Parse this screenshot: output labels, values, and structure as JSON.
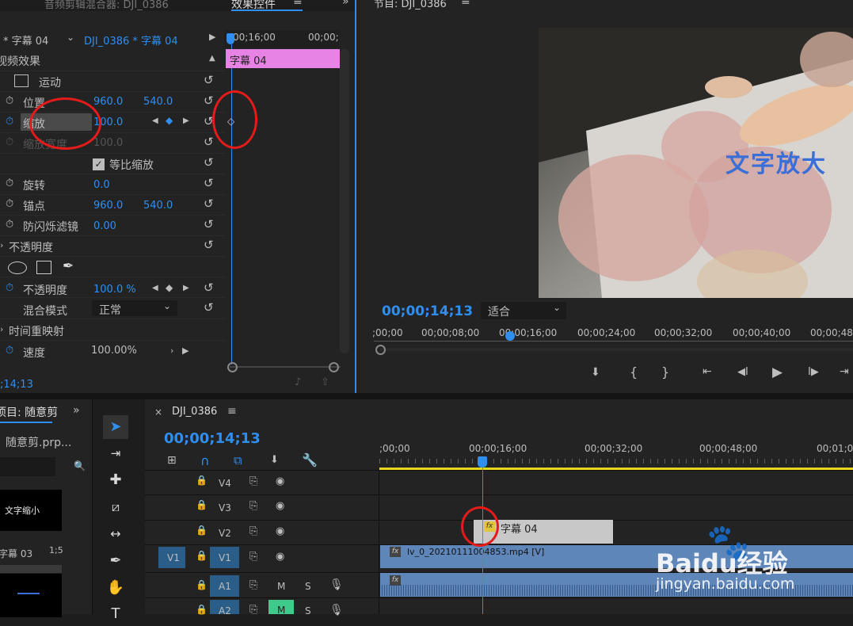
{
  "effect_controls": {
    "header_left": "音频剪辑混合器: DJI_0386",
    "header_tab": "效果控件",
    "source_clip": "* 字幕 04",
    "sequence_clip": "DJI_0386 * 字幕 04",
    "timecode_ruler": "00;16;00",
    "timecode_ruler_right": "00;00;",
    "clip_bar_label": "字幕 04",
    "video_effects_label": "视频效果",
    "motion_label": "运动",
    "position_label": "位置",
    "position_x": "960.0",
    "position_y": "540.0",
    "scale_label": "缩放",
    "scale_value": "100.0",
    "scale_width_label": "缩放宽度",
    "scale_width_value": "100.0",
    "uniform_scale_label": "等比缩放",
    "rotation_label": "旋转",
    "rotation_value": "0.0",
    "anchor_label": "锚点",
    "anchor_x": "960.0",
    "anchor_y": "540.0",
    "flicker_label": "防闪烁滤镜",
    "flicker_value": "0.00",
    "opacity_group_label": "不透明度",
    "opacity_label": "不透明度",
    "opacity_value": "100.0 %",
    "blend_label": "混合模式",
    "blend_value": "正常",
    "time_remap_label": "时间重映射",
    "speed_label": "速度",
    "speed_value": "100.00%",
    "bottom_timecode": ";14;13"
  },
  "program": {
    "header": "节目: DJI_0386",
    "overlay_text": "文字放大",
    "timecode": "00;00;14;13",
    "fit_label": "适合",
    "ruler_labels": [
      ";00;00",
      "00;00;08;00",
      "00;00;16;00",
      "00;00;24;00",
      "00;00;32;00",
      "00;00;40;00",
      "00;00;48"
    ]
  },
  "project": {
    "header": "项目: 随意剪",
    "file": "随意剪.prp...",
    "thumb1_text": "文字缩小",
    "thumb_label": "字幕 03",
    "thumb_duration": "1;5"
  },
  "timeline": {
    "tab": "DJI_0386",
    "timecode": "00;00;14;13",
    "ruler_labels": [
      ";00;00",
      "00;00;16;00",
      "00;00;32;00",
      "00;00;48;00",
      "00;01;0"
    ],
    "tracks": [
      "V4",
      "V3",
      "V2",
      "V1",
      "A1",
      "A2"
    ],
    "source_patch_v": "V1",
    "audio_m": "M",
    "audio_s": "S",
    "title_clip": "字幕 04",
    "video_clip": "lv_0_20210111004853.mp4 [V]"
  },
  "watermark": {
    "brand": "Baidu经验",
    "url": "jingyan.baidu.com"
  }
}
